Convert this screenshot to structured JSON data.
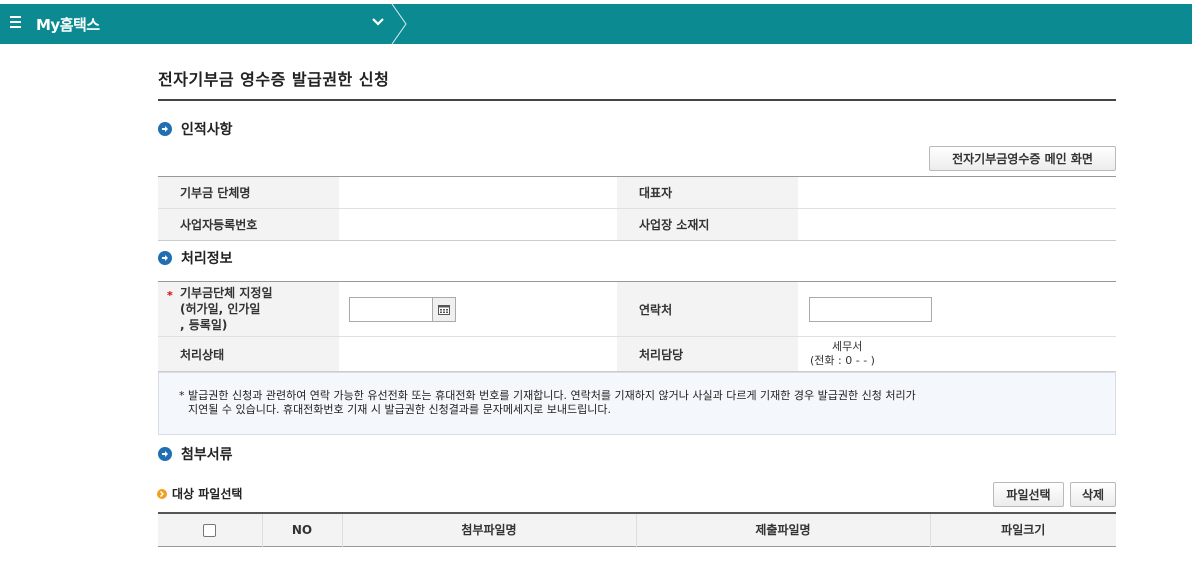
{
  "header": {
    "title": "My홈택스"
  },
  "page": {
    "title": "전자기부금 영수증 발급권한 신청"
  },
  "sections": {
    "personal": "인적사항",
    "process": "처리정보",
    "attach": "첨부서류"
  },
  "buttons": {
    "main_screen": "전자기부금영수증 메인 화면",
    "file_select": "파일선택",
    "delete": "삭제"
  },
  "personal": {
    "org_name_label": "기부금 단체명",
    "org_name_value": "",
    "rep_label": "대표자",
    "rep_value": "",
    "bizno_label": "사업자등록번호",
    "bizno_value": "",
    "addr_label": "사업장 소재지",
    "addr_value": ""
  },
  "process": {
    "required_mark": "*",
    "designation_label_1": "기부금단체 지정일",
    "designation_label_2": "(허가일, 인가일",
    "designation_label_3": ", 등록일)",
    "designation_value": "",
    "contact_label": "연락처",
    "contact_value": "",
    "status_label": "처리상태",
    "status_value": "",
    "officer_label": "처리담당",
    "officer_office": "세무서",
    "officer_phone": "(전화 : 0   -     -     )"
  },
  "notice": {
    "line1": "* 발급권한 신청과 관련하여 연락 가능한 유선전화 또는 휴대전화 번호를 기재합니다. 연락처를 기재하지 않거나 사실과 다르게 기재한 경우 발급권한 신청 처리가",
    "line2": "지연될 수 있습니다. 휴대전화번호 기재 시 발급권한 신청결과를 문자메세지로 보내드립니다."
  },
  "files": {
    "subtitle": "대상 파일선택",
    "columns": [
      "NO",
      "첨부파일명",
      "제출파일명",
      "파일크기"
    ]
  },
  "colors": {
    "header_bg": "#0b8a92",
    "section_dot": "#1f6fb2",
    "required": "#dd0000"
  }
}
